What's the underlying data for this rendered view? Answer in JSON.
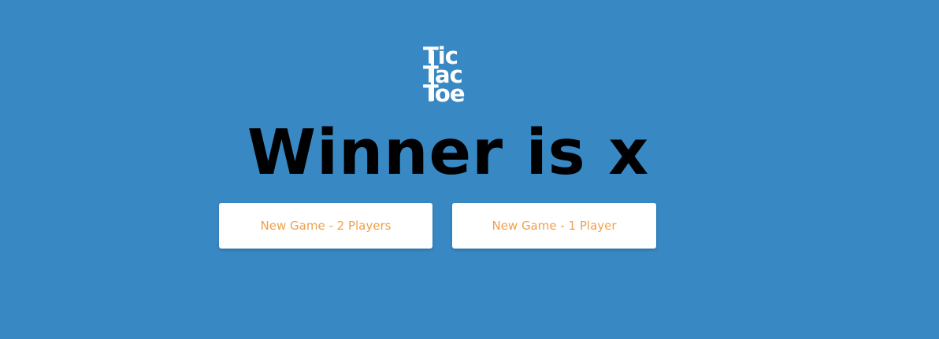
{
  "logo": {
    "line1": "Tic",
    "line2": "Tac",
    "line3": "Toe"
  },
  "status": {
    "message": "Winner is x"
  },
  "buttons": {
    "new_game_two_players": "New Game - 2 Players",
    "new_game_one_player": "New Game - 1 Player"
  },
  "colors": {
    "background": "#3888c4",
    "logo_text": "#ffffff",
    "headline_text": "#000000",
    "button_background": "#ffffff",
    "button_text": "#f0a04a"
  }
}
